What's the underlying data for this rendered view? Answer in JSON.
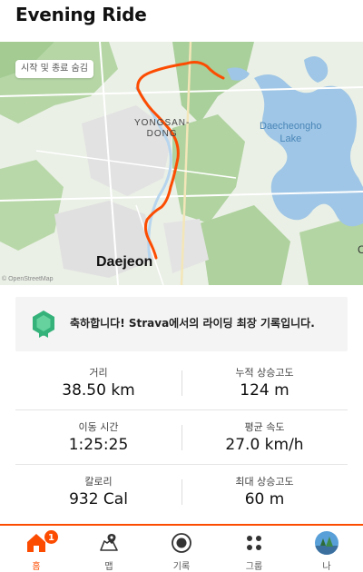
{
  "header": {
    "title": "Evening Ride"
  },
  "map": {
    "hide_toggle_label": "시작 및 종료 숨김",
    "labels": {
      "district_line1": "YONGSAN-",
      "district_line2": "DONG",
      "lake_line1": "Daecheongho",
      "lake_line2": "Lake",
      "city": "Daejeon",
      "edge_letter": "C",
      "copyright": "© OpenStreetMap"
    },
    "route_color": "#fc4c02"
  },
  "achievement": {
    "icon": "medal-icon",
    "text": "축하합니다! Strava에서의 라이딩 최장 기록입니다."
  },
  "stats": [
    {
      "left": {
        "label": "거리",
        "value": "38.50 km"
      },
      "right": {
        "label": "누적 상승고도",
        "value": "124 m"
      }
    },
    {
      "left": {
        "label": "이동 시간",
        "value": "1:25:25"
      },
      "right": {
        "label": "평균 속도",
        "value": "27.0 km/h"
      }
    },
    {
      "left": {
        "label": "칼로리",
        "value": "932 Cal"
      },
      "right": {
        "label": "최대 상승고도",
        "value": "60 m"
      }
    }
  ],
  "tabs": [
    {
      "label": "홈",
      "icon": "home-icon",
      "active": true,
      "badge": "1"
    },
    {
      "label": "맵",
      "icon": "map-icon"
    },
    {
      "label": "기록",
      "icon": "record-icon"
    },
    {
      "label": "그룹",
      "icon": "groups-icon"
    },
    {
      "label": "나",
      "icon": "avatar"
    }
  ],
  "colors": {
    "accent": "#fc4c02",
    "water": "#9fc6e6",
    "forest": "#a9cf9a"
  }
}
